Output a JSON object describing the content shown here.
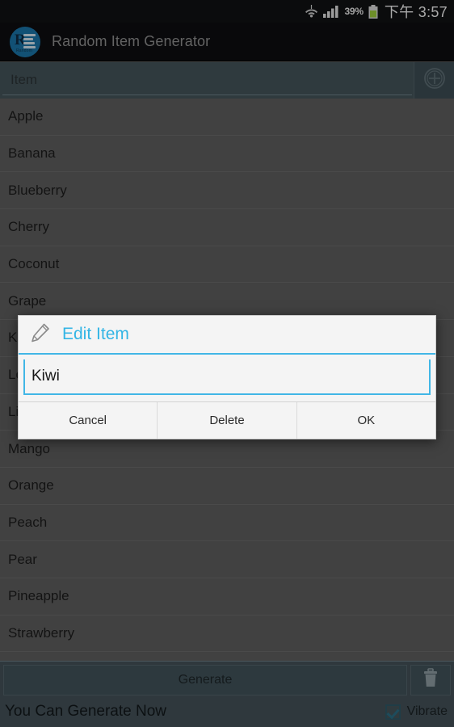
{
  "status_bar": {
    "wifi_icon": "wifi-icon",
    "signal_icon": "cellular-signal-icon",
    "battery_percent": "39%",
    "battery_icon": "battery-icon",
    "clock": "下午 3:57"
  },
  "action_bar": {
    "logo_icon": "app-logo-icon",
    "logo_letter": "R",
    "logo_subtext": "Random",
    "title": "Random Item Generator"
  },
  "input_row": {
    "placeholder": "Item",
    "value": "",
    "add_icon": "circle-plus-icon"
  },
  "list": {
    "items": [
      "Apple",
      "Banana",
      "Blueberry",
      "Cherry",
      "Coconut",
      "Grape",
      "Kiwi",
      "Lemon",
      "Lime",
      "Mango",
      "Orange",
      "Peach",
      "Pear",
      "Pineapple",
      "Strawberry"
    ]
  },
  "footer": {
    "generate_label": "Generate",
    "trash_icon": "trash-icon",
    "status_text": "You Can Generate Now",
    "vibrate_label": "Vibrate",
    "vibrate_checked": true
  },
  "dialog": {
    "icon": "pencil-edit-icon",
    "title": "Edit Item",
    "input_value": "Kiwi",
    "buttons": [
      {
        "label": "Cancel",
        "name": "cancel-button"
      },
      {
        "label": "Delete",
        "name": "delete-button"
      },
      {
        "label": "OK",
        "name": "ok-button"
      }
    ]
  },
  "colors": {
    "accent_blue": "#33b5e5",
    "underline_blue": "#41b6e6",
    "logo_blue": "#1a74a8",
    "footer_slate": "#445158",
    "list_gray": "#5e5e5e",
    "actionbar_black": "#0d0e10",
    "battery_green": "#9ccc3c"
  }
}
